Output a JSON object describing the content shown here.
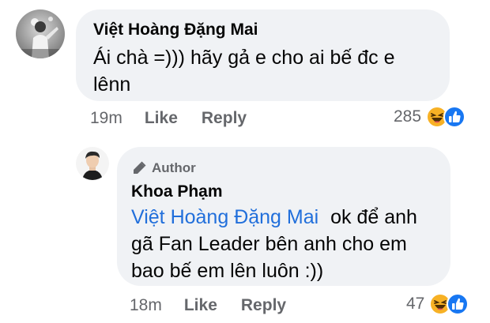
{
  "comment": {
    "author": "Việt Hoàng Đặng Mai",
    "text": "Ái chà =))) hãy gả e cho ai bế đc e lênn",
    "time": "19m",
    "like_label": "Like",
    "reply_label": "Reply",
    "reaction_count": "285",
    "reaction_icons": [
      "haha-icon",
      "like-icon"
    ]
  },
  "reply": {
    "badge": "Author",
    "badge_icon": "pen-icon",
    "author": "Khoa Phạm",
    "mention": "Việt Hoàng Đặng Mai",
    "text": "ok để anh gã Fan Leader bên anh cho em bao bế em lên luôn :))",
    "time": "18m",
    "like_label": "Like",
    "reply_label": "Reply",
    "reaction_count": "47",
    "reaction_icons": [
      "haha-icon",
      "like-icon"
    ]
  },
  "colors": {
    "bubble": "#f0f2f5",
    "mention": "#216fdb",
    "muted": "#65676b",
    "like_blue": "#1877f2",
    "haha_yellow": "#f7b125"
  }
}
